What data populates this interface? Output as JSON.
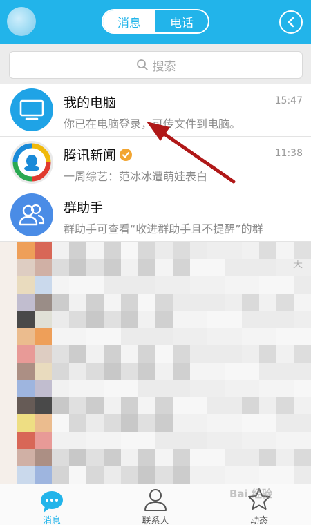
{
  "header": {
    "tabs": [
      {
        "label": "消息",
        "active": true
      },
      {
        "label": "电话",
        "active": false
      }
    ],
    "accent_color": "#22b4ea"
  },
  "search": {
    "placeholder": "搜索",
    "icon": "search-icon"
  },
  "conversations": [
    {
      "title": "我的电脑",
      "preview": "你已在电脑登录，可传文件到电脑。",
      "time": "15:47",
      "icon": "monitor-icon"
    },
    {
      "title": "腾讯新闻",
      "preview": "一周综艺：范冰冰遭萌娃表白",
      "time": "11:38",
      "icon": "tencent-news-icon",
      "verified": true
    },
    {
      "title": "群助手",
      "preview": "群助手可查看“收进群助手且不提醒”的群",
      "time": "",
      "icon": "group-assistant-icon"
    }
  ],
  "blurred_time": "天",
  "tabbar": {
    "tabs": [
      {
        "label": "消息",
        "icon": "chat-bubble-icon",
        "active": true
      },
      {
        "label": "联系人",
        "icon": "contact-person-icon",
        "active": false
      },
      {
        "label": "动态",
        "icon": "star-icon",
        "active": false
      }
    ]
  },
  "watermark": "Bai 经验",
  "annotation": {
    "type": "arrow",
    "color": "#b01818"
  }
}
